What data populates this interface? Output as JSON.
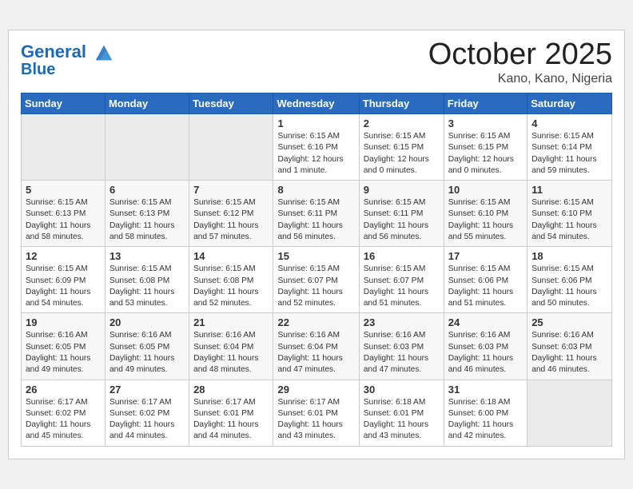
{
  "header": {
    "logo_line1": "General",
    "logo_line2": "Blue",
    "month": "October 2025",
    "location": "Kano, Kano, Nigeria"
  },
  "weekdays": [
    "Sunday",
    "Monday",
    "Tuesday",
    "Wednesday",
    "Thursday",
    "Friday",
    "Saturday"
  ],
  "weeks": [
    [
      {
        "day": "",
        "info": ""
      },
      {
        "day": "",
        "info": ""
      },
      {
        "day": "",
        "info": ""
      },
      {
        "day": "1",
        "info": "Sunrise: 6:15 AM\nSunset: 6:16 PM\nDaylight: 12 hours\nand 1 minute."
      },
      {
        "day": "2",
        "info": "Sunrise: 6:15 AM\nSunset: 6:15 PM\nDaylight: 12 hours\nand 0 minutes."
      },
      {
        "day": "3",
        "info": "Sunrise: 6:15 AM\nSunset: 6:15 PM\nDaylight: 12 hours\nand 0 minutes."
      },
      {
        "day": "4",
        "info": "Sunrise: 6:15 AM\nSunset: 6:14 PM\nDaylight: 11 hours\nand 59 minutes."
      }
    ],
    [
      {
        "day": "5",
        "info": "Sunrise: 6:15 AM\nSunset: 6:13 PM\nDaylight: 11 hours\nand 58 minutes."
      },
      {
        "day": "6",
        "info": "Sunrise: 6:15 AM\nSunset: 6:13 PM\nDaylight: 11 hours\nand 58 minutes."
      },
      {
        "day": "7",
        "info": "Sunrise: 6:15 AM\nSunset: 6:12 PM\nDaylight: 11 hours\nand 57 minutes."
      },
      {
        "day": "8",
        "info": "Sunrise: 6:15 AM\nSunset: 6:11 PM\nDaylight: 11 hours\nand 56 minutes."
      },
      {
        "day": "9",
        "info": "Sunrise: 6:15 AM\nSunset: 6:11 PM\nDaylight: 11 hours\nand 56 minutes."
      },
      {
        "day": "10",
        "info": "Sunrise: 6:15 AM\nSunset: 6:10 PM\nDaylight: 11 hours\nand 55 minutes."
      },
      {
        "day": "11",
        "info": "Sunrise: 6:15 AM\nSunset: 6:10 PM\nDaylight: 11 hours\nand 54 minutes."
      }
    ],
    [
      {
        "day": "12",
        "info": "Sunrise: 6:15 AM\nSunset: 6:09 PM\nDaylight: 11 hours\nand 54 minutes."
      },
      {
        "day": "13",
        "info": "Sunrise: 6:15 AM\nSunset: 6:08 PM\nDaylight: 11 hours\nand 53 minutes."
      },
      {
        "day": "14",
        "info": "Sunrise: 6:15 AM\nSunset: 6:08 PM\nDaylight: 11 hours\nand 52 minutes."
      },
      {
        "day": "15",
        "info": "Sunrise: 6:15 AM\nSunset: 6:07 PM\nDaylight: 11 hours\nand 52 minutes."
      },
      {
        "day": "16",
        "info": "Sunrise: 6:15 AM\nSunset: 6:07 PM\nDaylight: 11 hours\nand 51 minutes."
      },
      {
        "day": "17",
        "info": "Sunrise: 6:15 AM\nSunset: 6:06 PM\nDaylight: 11 hours\nand 51 minutes."
      },
      {
        "day": "18",
        "info": "Sunrise: 6:15 AM\nSunset: 6:06 PM\nDaylight: 11 hours\nand 50 minutes."
      }
    ],
    [
      {
        "day": "19",
        "info": "Sunrise: 6:16 AM\nSunset: 6:05 PM\nDaylight: 11 hours\nand 49 minutes."
      },
      {
        "day": "20",
        "info": "Sunrise: 6:16 AM\nSunset: 6:05 PM\nDaylight: 11 hours\nand 49 minutes."
      },
      {
        "day": "21",
        "info": "Sunrise: 6:16 AM\nSunset: 6:04 PM\nDaylight: 11 hours\nand 48 minutes."
      },
      {
        "day": "22",
        "info": "Sunrise: 6:16 AM\nSunset: 6:04 PM\nDaylight: 11 hours\nand 47 minutes."
      },
      {
        "day": "23",
        "info": "Sunrise: 6:16 AM\nSunset: 6:03 PM\nDaylight: 11 hours\nand 47 minutes."
      },
      {
        "day": "24",
        "info": "Sunrise: 6:16 AM\nSunset: 6:03 PM\nDaylight: 11 hours\nand 46 minutes."
      },
      {
        "day": "25",
        "info": "Sunrise: 6:16 AM\nSunset: 6:03 PM\nDaylight: 11 hours\nand 46 minutes."
      }
    ],
    [
      {
        "day": "26",
        "info": "Sunrise: 6:17 AM\nSunset: 6:02 PM\nDaylight: 11 hours\nand 45 minutes."
      },
      {
        "day": "27",
        "info": "Sunrise: 6:17 AM\nSunset: 6:02 PM\nDaylight: 11 hours\nand 44 minutes."
      },
      {
        "day": "28",
        "info": "Sunrise: 6:17 AM\nSunset: 6:01 PM\nDaylight: 11 hours\nand 44 minutes."
      },
      {
        "day": "29",
        "info": "Sunrise: 6:17 AM\nSunset: 6:01 PM\nDaylight: 11 hours\nand 43 minutes."
      },
      {
        "day": "30",
        "info": "Sunrise: 6:18 AM\nSunset: 6:01 PM\nDaylight: 11 hours\nand 43 minutes."
      },
      {
        "day": "31",
        "info": "Sunrise: 6:18 AM\nSunset: 6:00 PM\nDaylight: 11 hours\nand 42 minutes."
      },
      {
        "day": "",
        "info": ""
      }
    ]
  ]
}
